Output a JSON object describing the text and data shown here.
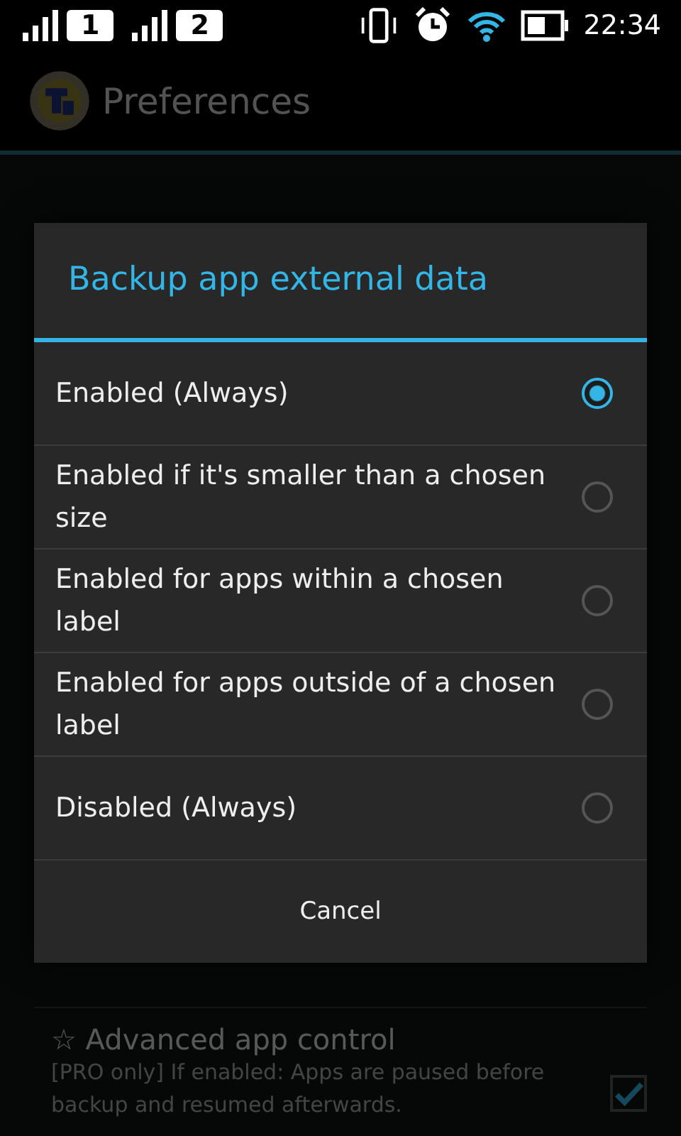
{
  "status_bar": {
    "sim_1": "1",
    "sim_2": "2",
    "time": "22:34"
  },
  "action_bar": {
    "title": "Preferences"
  },
  "preferences": [
    {
      "star": "☆",
      "title": "Advanced app control",
      "summary": "[PRO only] If enabled: Apps are paused before backup and resumed afterwards.",
      "checked": true
    }
  ],
  "dialog": {
    "title": "Backup app external data",
    "options": [
      {
        "label": "Enabled (Always)",
        "selected": true
      },
      {
        "label": "Enabled if it's smaller than a chosen size",
        "selected": false
      },
      {
        "label": "Enabled for apps within a chosen label",
        "selected": false
      },
      {
        "label": "Enabled for apps outside of a chosen label",
        "selected": false
      },
      {
        "label": "Disabled (Always)",
        "selected": false
      }
    ],
    "buttons": [
      "Cancel"
    ]
  }
}
